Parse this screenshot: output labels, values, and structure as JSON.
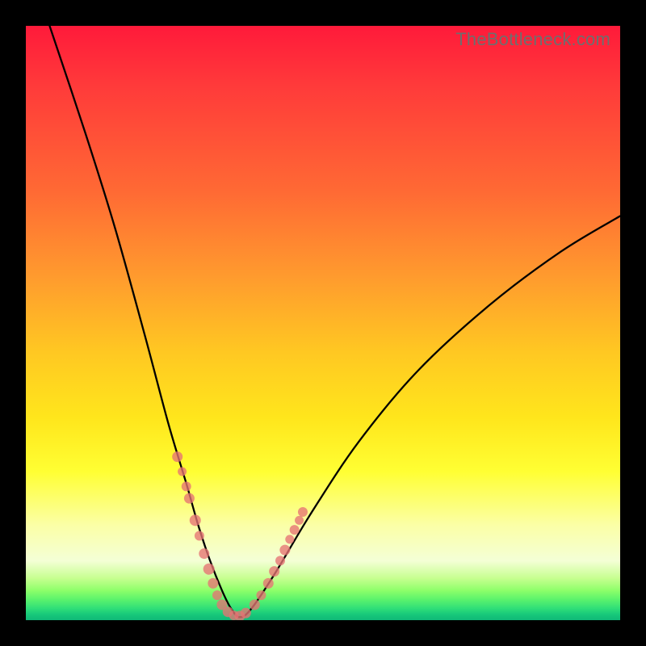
{
  "watermark": "TheBottleneck.com",
  "colors": {
    "frame": "#000000",
    "curve": "#000000",
    "marker": "#e57373",
    "gradient_top": "#ff1a3a",
    "gradient_bottom": "#0fb877"
  },
  "chart_data": {
    "type": "line",
    "title": "",
    "xlabel": "",
    "ylabel": "",
    "xlim": [
      0,
      100
    ],
    "ylim": [
      0,
      100
    ],
    "note": "Axes are unlabeled in the source image; x is an implicit parameter along the horizontal, y is bottleneck-like score (lower = greener).",
    "series": [
      {
        "name": "curve",
        "x": [
          4,
          10,
          15,
          20,
          24,
          27,
          29,
          31,
          33,
          34.5,
          36,
          38,
          42,
          48,
          56,
          66,
          78,
          90,
          100
        ],
        "y": [
          100,
          82,
          66,
          48,
          33,
          23,
          16,
          10,
          5,
          2,
          0.5,
          2,
          8,
          18,
          30,
          42,
          53,
          62,
          68
        ]
      }
    ],
    "markers": {
      "name": "highlighted-points",
      "x": [
        25.5,
        26.3,
        27.0,
        27.5,
        28.5,
        29.2,
        30.0,
        30.8,
        31.5,
        32.2,
        33.0,
        34.0,
        35.0,
        36.0,
        37.0,
        38.5,
        39.6,
        40.8,
        41.8,
        42.8,
        43.6,
        44.4,
        45.2,
        46.0,
        46.6
      ],
      "y": [
        27.5,
        25.0,
        22.5,
        20.5,
        16.8,
        14.2,
        11.2,
        8.6,
        6.2,
        4.2,
        2.6,
        1.4,
        0.8,
        0.7,
        1.2,
        2.6,
        4.2,
        6.2,
        8.2,
        10.0,
        11.8,
        13.6,
        15.2,
        16.8,
        18.2
      ],
      "r": [
        6.5,
        5.5,
        6.0,
        6.5,
        7.0,
        6.0,
        6.5,
        7.0,
        6.5,
        6.0,
        6.5,
        6.5,
        6.0,
        6.5,
        6.5,
        6.5,
        6.0,
        6.5,
        6.5,
        6.0,
        6.5,
        5.5,
        6.0,
        5.5,
        6.0
      ]
    }
  }
}
